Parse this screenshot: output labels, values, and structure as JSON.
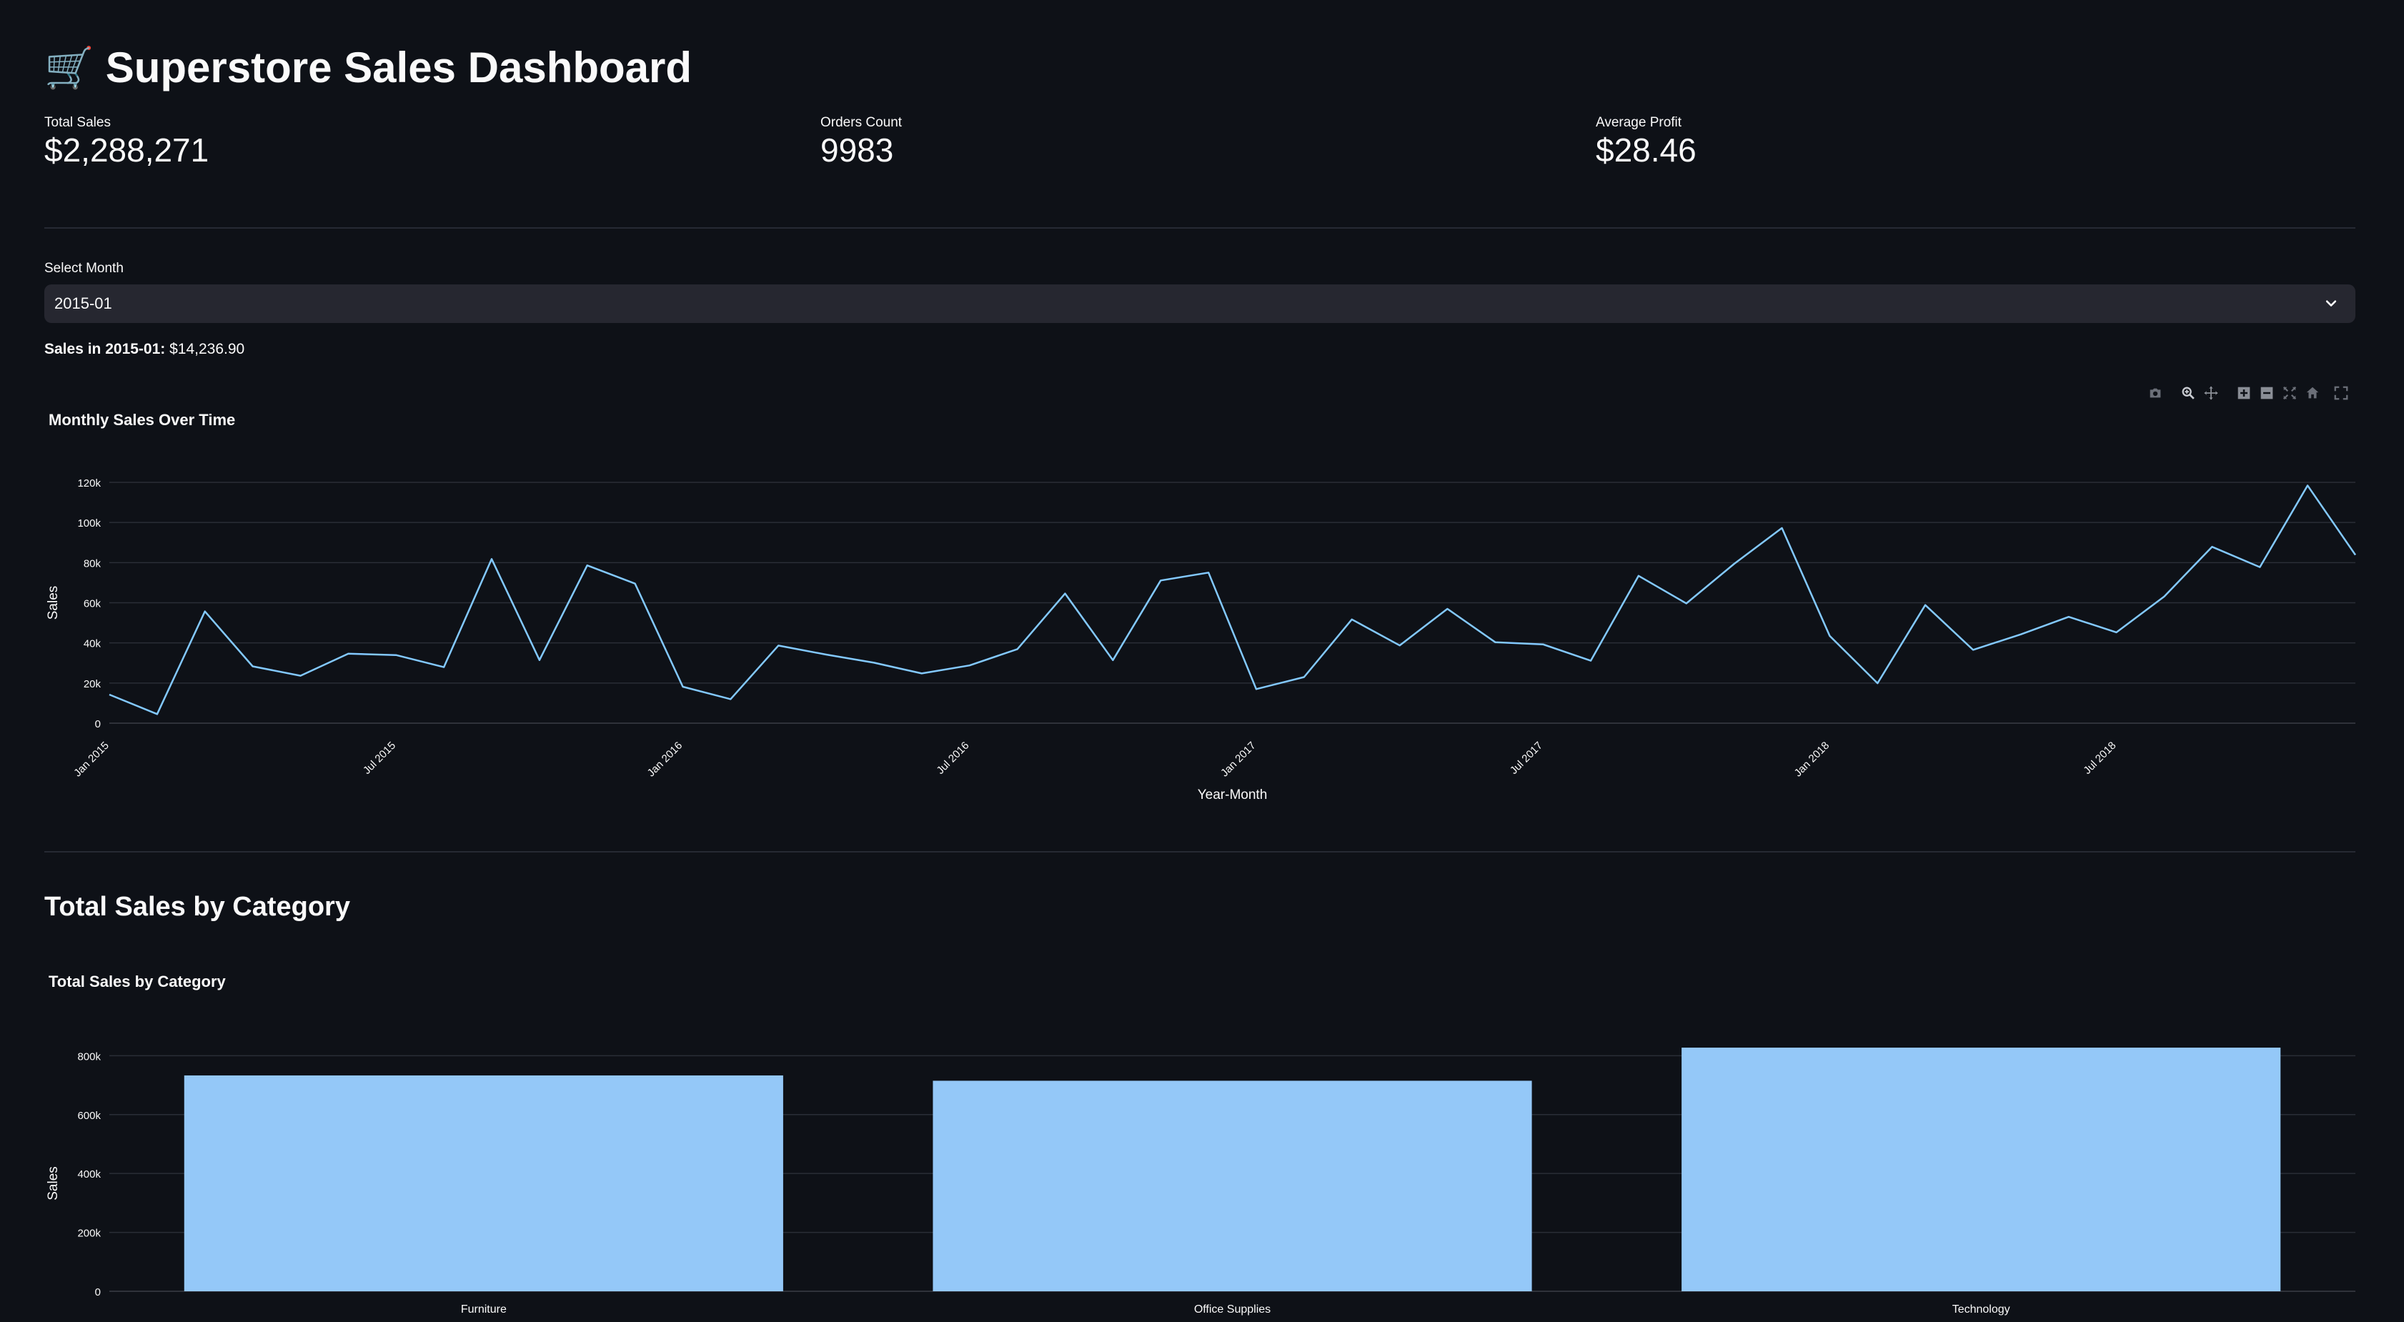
{
  "page": {
    "title": "Superstore Sales Dashboard",
    "title_icon": "shopping-cart-icon"
  },
  "metrics": [
    {
      "label": "Total Sales",
      "value": "$2,288,271"
    },
    {
      "label": "Orders Count",
      "value": "9983"
    },
    {
      "label": "Average Profit",
      "value": "$28.46"
    }
  ],
  "month_select": {
    "label": "Select Month",
    "value": "2015-01"
  },
  "selected_sales": {
    "prefix": "Sales in 2015-01:",
    "value": "$14,236.90"
  },
  "modebar_icons": [
    "camera-icon",
    "zoom-icon",
    "pan-icon",
    "zoom-in-icon",
    "zoom-out-icon",
    "autoscale-icon",
    "home-icon",
    "fullscreen-icon"
  ],
  "line_chart_data": {
    "type": "line",
    "title": "Monthly Sales Over Time",
    "xlabel": "Year-Month",
    "ylabel": "Sales",
    "ylim": [
      0,
      120000
    ],
    "yticks": [
      0,
      20000,
      40000,
      60000,
      80000,
      100000,
      120000
    ],
    "ytick_labels": [
      "0",
      "20k",
      "40k",
      "60k",
      "80k",
      "100k",
      "120k"
    ],
    "xtick_labels": [
      "Jan 2015",
      "Jul 2015",
      "Jan 2016",
      "Jul 2016",
      "Jan 2017",
      "Jul 2017",
      "Jan 2018",
      "Jul 2018"
    ],
    "xtick_index": [
      0,
      6,
      12,
      18,
      24,
      30,
      36,
      42
    ],
    "grid": true,
    "color": "#83c9ff",
    "values": [
      14237,
      4520,
      55691,
      28295,
      23648,
      34595,
      33946,
      27909,
      81777,
      31453,
      78629,
      69546,
      18174,
      11951,
      38679,
      34195,
      30132,
      24797,
      28765,
      36898,
      64596,
      31405,
      71115,
      75043,
      17000,
      22979,
      51716,
      38750,
      56988,
      40344,
      39262,
      31115,
      73410,
      59688,
      79412,
      97237,
      43476,
      19921,
      58863,
      36522,
      44261,
      52982,
      45264,
      63121,
      87867,
      77777,
      118448,
      83829
    ]
  },
  "bar_section_title": "Total Sales by Category",
  "bar_chart_data": {
    "type": "bar",
    "title": "Total Sales by Category",
    "xlabel": "",
    "ylabel": "Sales",
    "categories": [
      "Furniture",
      "Office Supplies",
      "Technology"
    ],
    "values": [
      733047,
      714970,
      827456
    ],
    "ylim": [
      0,
      830000
    ],
    "yticks": [
      0,
      200000,
      400000,
      600000,
      800000
    ],
    "ytick_labels": [
      "0",
      "200k",
      "400k",
      "600k",
      "800k"
    ],
    "grid": true,
    "color": "#94c8f8"
  }
}
